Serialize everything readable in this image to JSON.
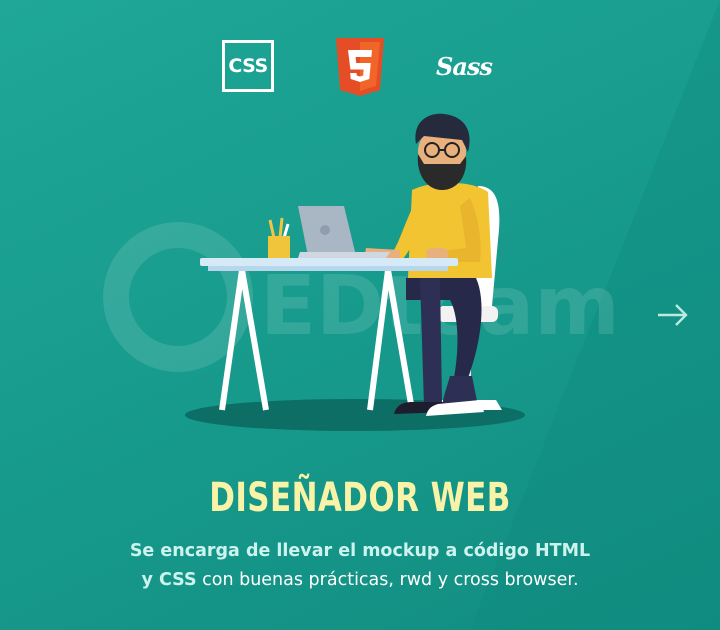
{
  "colors": {
    "background": "#1aa191",
    "title": "#f9f3a8",
    "text": "#ffffff"
  },
  "icons": {
    "css_label": "CSS",
    "html_label": "5",
    "sass_label": "Sass"
  },
  "watermark": {
    "brand": "EDteam"
  },
  "title": "DISEÑADOR WEB",
  "description": {
    "line1": "Se encarga de llevar el mockup a código HTML",
    "line2_bold": "y CSS",
    "line2_rest": " con buenas prácticas, rwd y cross browser."
  }
}
